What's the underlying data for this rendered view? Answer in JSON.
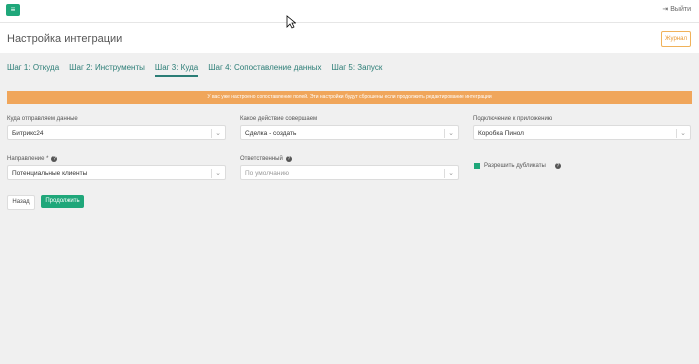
{
  "topbar": {
    "menu_icon": "menu-icon",
    "logout_label": "Выйти",
    "logout_icon": "logout-icon"
  },
  "header": {
    "title": "Настройка интеграции",
    "journal_label": "Журнал"
  },
  "tabs": [
    {
      "label": "Шаг 1: Откуда",
      "active": false
    },
    {
      "label": "Шаг 2: Инструменты",
      "active": false
    },
    {
      "label": "Шаг 3: Куда",
      "active": true
    },
    {
      "label": "Шаг 4: Сопоставление данных",
      "active": false
    },
    {
      "label": "Шаг 5: Запуск",
      "active": false
    }
  ],
  "warning": {
    "text": "У вас уже настроено сопоставление полей. Эти настройки будут сброшены если продолжить редактирование интеграции"
  },
  "fields": {
    "destination": {
      "label": "Куда отправляем данные",
      "value": "Битрикс24"
    },
    "action": {
      "label": "Какое действие совершаем",
      "value": "Сделка - создать"
    },
    "connection": {
      "label": "Подключение к приложению",
      "value": "Коробка Пинол"
    },
    "direction": {
      "label": "Направление *",
      "value": "Потенциальные клиенты"
    },
    "responsible": {
      "label": "Ответственный",
      "placeholder": "По умолчанию"
    }
  },
  "duplicates": {
    "label": "Разрешить дубликаты",
    "checked": true
  },
  "buttons": {
    "back": "Назад",
    "next": "Продолжить"
  },
  "colors": {
    "accent": "#1fa77a",
    "tab": "#2b7d76",
    "warning": "#f0a65b",
    "journal": "#e99a34"
  }
}
